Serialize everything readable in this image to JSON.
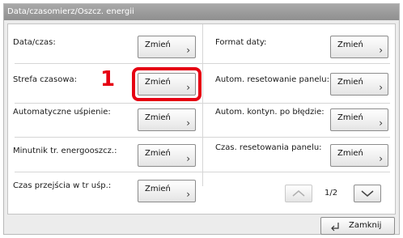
{
  "window": {
    "title": "Data/czasomierz/Oszcz. energii"
  },
  "rows": [
    {
      "left_label": "Data/czas:",
      "left_button": "Zmień",
      "right_label": "Format daty:",
      "right_button": "Zmień"
    },
    {
      "left_label": "Strefa czasowa:",
      "left_button": "Zmień",
      "right_label": "Autom. resetowanie panelu:",
      "right_button": "Zmień"
    },
    {
      "left_label": "Automatyczne uśpienie:",
      "left_button": "Zmień",
      "right_label": "Autom. kontyn. po błędzie:",
      "right_button": "Zmień"
    },
    {
      "left_label": "Minutnik tr. energooszcz.:",
      "left_button": "Zmień",
      "right_label": "Czas. resetowania panelu:",
      "right_button": "Zmień"
    },
    {
      "left_label": "Czas przejścia w tr uśp.:",
      "left_button": "Zmień"
    }
  ],
  "callout": {
    "number": "1"
  },
  "pagination": {
    "indicator": "1/2"
  },
  "footer": {
    "close_label": "Zamknij"
  },
  "colors": {
    "highlight": "#e60012",
    "titlebar": "#9a9a9a"
  },
  "icons": {
    "chevron": "chevron-right-icon",
    "up": "chevron-up-icon",
    "down": "chevron-down-icon",
    "close": "return-arrow-icon"
  }
}
